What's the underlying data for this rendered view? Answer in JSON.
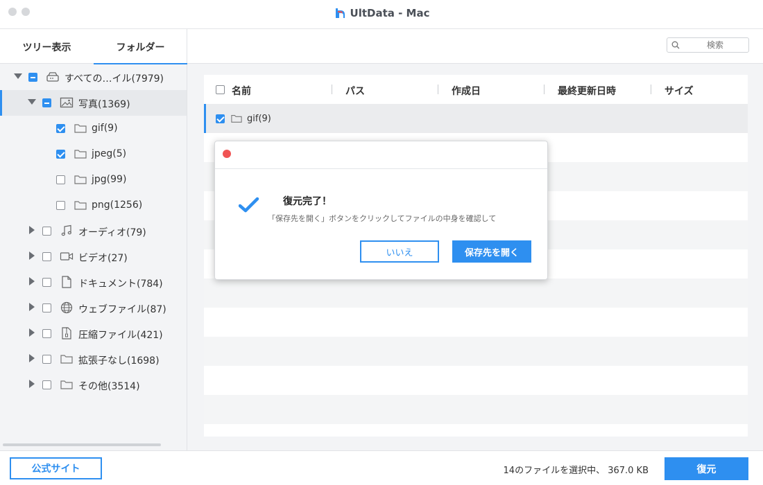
{
  "window": {
    "title": "UltData - Mac",
    "accent": "#2e8ff0"
  },
  "sidebar": {
    "tabs": [
      {
        "label": "ツリー表示",
        "active": false
      },
      {
        "label": "フォルダー",
        "active": true
      }
    ],
    "tree": [
      {
        "label": "すべての…イル(7979)",
        "icon": "drive-icon",
        "state": "partial",
        "expanded": true
      },
      {
        "label": "写真(1369)",
        "icon": "image-icon",
        "state": "partial",
        "expanded": true,
        "selected": true
      },
      {
        "label": "gif(9)",
        "icon": "folder-icon",
        "state": "checked"
      },
      {
        "label": "jpeg(5)",
        "icon": "folder-icon",
        "state": "checked"
      },
      {
        "label": "jpg(99)",
        "icon": "folder-icon",
        "state": "unchecked"
      },
      {
        "label": "png(1256)",
        "icon": "folder-icon",
        "state": "unchecked"
      },
      {
        "label": "オーディオ(79)",
        "icon": "music-icon",
        "state": "unchecked"
      },
      {
        "label": "ビデオ(27)",
        "icon": "video-icon",
        "state": "unchecked"
      },
      {
        "label": "ドキュメント(784)",
        "icon": "document-icon",
        "state": "unchecked"
      },
      {
        "label": "ウェブファイル(87)",
        "icon": "globe-icon",
        "state": "unchecked"
      },
      {
        "label": "圧縮ファイル(421)",
        "icon": "zip-icon",
        "state": "unchecked"
      },
      {
        "label": "拡張子なし(1698)",
        "icon": "folder-icon",
        "state": "unchecked"
      },
      {
        "label": "その他(3514)",
        "icon": "folder-icon",
        "state": "unchecked"
      }
    ]
  },
  "search": {
    "placeholder": "検索"
  },
  "table": {
    "columns": [
      "名前",
      "パス",
      "作成日",
      "最終更新日時",
      "サイズ"
    ],
    "rows": [
      {
        "name": "gif(9)",
        "checked": true
      }
    ]
  },
  "dialog": {
    "title": "復元完了！",
    "message": "「保存先を開く」ボタンをクリックしてファイルの中身を確認して",
    "no_label": "いいえ",
    "yes_label": "保存先を開く"
  },
  "footer": {
    "site_label": "公式サイト",
    "status": "14のファイルを選択中、 367.0 KB",
    "restore_label": "復元"
  }
}
